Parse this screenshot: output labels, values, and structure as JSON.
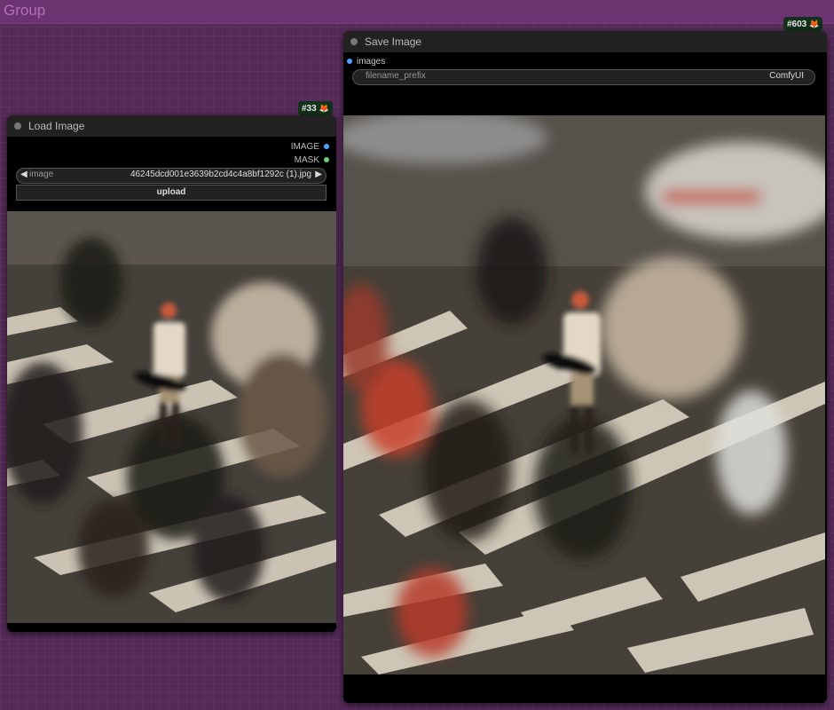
{
  "group": {
    "title": "Group"
  },
  "load_node": {
    "title": "Load Image",
    "badge": "#33",
    "outputs": [
      {
        "label": "IMAGE",
        "color": "#4aa3ff"
      },
      {
        "label": "MASK",
        "color": "#6ecf6e"
      }
    ],
    "image_widget": {
      "label": "image",
      "value": "46245dcd001e3639b2cd4c4a8bf1292c (1).jpg"
    },
    "upload_label": "upload"
  },
  "save_node": {
    "title": "Save Image",
    "badge": "#603",
    "input": {
      "label": "images",
      "color": "#4aa3ff"
    },
    "prefix_widget": {
      "label": "filename_prefix",
      "value": "ComfyUI"
    }
  },
  "icons": {
    "badge_icon": "fox-icon",
    "arrow_left": "arrow-left-icon",
    "arrow_right": "arrow-right-icon"
  },
  "colors": {
    "group_bg": "#542a57",
    "group_header": "#6b3370",
    "node_bg": "#000000",
    "node_title_bg": "#222222"
  }
}
